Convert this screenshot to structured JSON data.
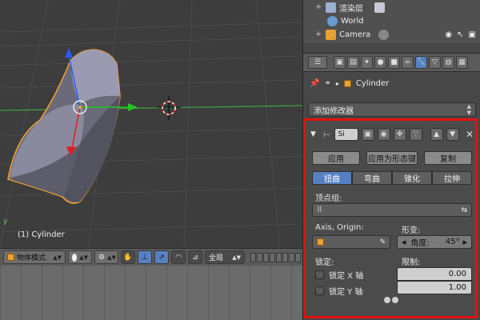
{
  "viewport": {
    "object_label": "(1) Cylinder",
    "axis_label": "y"
  },
  "viewport_header": {
    "mode": "物体模式",
    "orientation": "全局"
  },
  "outliner": {
    "rows": [
      {
        "label": "渲染层"
      },
      {
        "label": "World"
      },
      {
        "label": "Camera"
      }
    ]
  },
  "properties": {
    "breadcrumb_object": "Cylinder",
    "add_modifier": "添加修改器"
  },
  "modifier": {
    "name": "Si",
    "buttons": {
      "apply": "应用",
      "apply_shape": "应用为形态键",
      "copy": "复制"
    },
    "modes": [
      {
        "label": "扭曲",
        "active": true
      },
      {
        "label": "弯曲",
        "active": false
      },
      {
        "label": "锥化",
        "active": false
      },
      {
        "label": "拉伸",
        "active": false
      }
    ],
    "vertex_group_label": "顶点组:",
    "axis_origin_label": "Axis, Origin:",
    "deform_label": "形变:",
    "angle_label": "角度:",
    "angle_value": "45°",
    "lock_label": "锁定:",
    "limit_label": "限制:",
    "lock_x": "锁定 X 轴",
    "lock_y": "锁定 Y 轴",
    "limit_min": "0.00",
    "limit_max": "1.00"
  },
  "colors": {
    "highlight": "#e81010",
    "active_blue": "#5680c2",
    "object_outline": "#f0a030"
  }
}
